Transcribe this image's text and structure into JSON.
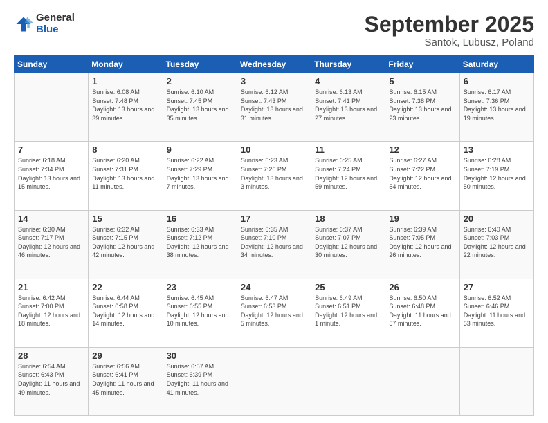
{
  "logo": {
    "general": "General",
    "blue": "Blue"
  },
  "title": {
    "month": "September 2025",
    "location": "Santok, Lubusz, Poland"
  },
  "days_of_week": [
    "Sunday",
    "Monday",
    "Tuesday",
    "Wednesday",
    "Thursday",
    "Friday",
    "Saturday"
  ],
  "weeks": [
    [
      {
        "day": "",
        "sunrise": "",
        "sunset": "",
        "daylight": ""
      },
      {
        "day": "1",
        "sunrise": "Sunrise: 6:08 AM",
        "sunset": "Sunset: 7:48 PM",
        "daylight": "Daylight: 13 hours and 39 minutes."
      },
      {
        "day": "2",
        "sunrise": "Sunrise: 6:10 AM",
        "sunset": "Sunset: 7:45 PM",
        "daylight": "Daylight: 13 hours and 35 minutes."
      },
      {
        "day": "3",
        "sunrise": "Sunrise: 6:12 AM",
        "sunset": "Sunset: 7:43 PM",
        "daylight": "Daylight: 13 hours and 31 minutes."
      },
      {
        "day": "4",
        "sunrise": "Sunrise: 6:13 AM",
        "sunset": "Sunset: 7:41 PM",
        "daylight": "Daylight: 13 hours and 27 minutes."
      },
      {
        "day": "5",
        "sunrise": "Sunrise: 6:15 AM",
        "sunset": "Sunset: 7:38 PM",
        "daylight": "Daylight: 13 hours and 23 minutes."
      },
      {
        "day": "6",
        "sunrise": "Sunrise: 6:17 AM",
        "sunset": "Sunset: 7:36 PM",
        "daylight": "Daylight: 13 hours and 19 minutes."
      }
    ],
    [
      {
        "day": "7",
        "sunrise": "Sunrise: 6:18 AM",
        "sunset": "Sunset: 7:34 PM",
        "daylight": "Daylight: 13 hours and 15 minutes."
      },
      {
        "day": "8",
        "sunrise": "Sunrise: 6:20 AM",
        "sunset": "Sunset: 7:31 PM",
        "daylight": "Daylight: 13 hours and 11 minutes."
      },
      {
        "day": "9",
        "sunrise": "Sunrise: 6:22 AM",
        "sunset": "Sunset: 7:29 PM",
        "daylight": "Daylight: 13 hours and 7 minutes."
      },
      {
        "day": "10",
        "sunrise": "Sunrise: 6:23 AM",
        "sunset": "Sunset: 7:26 PM",
        "daylight": "Daylight: 13 hours and 3 minutes."
      },
      {
        "day": "11",
        "sunrise": "Sunrise: 6:25 AM",
        "sunset": "Sunset: 7:24 PM",
        "daylight": "Daylight: 12 hours and 59 minutes."
      },
      {
        "day": "12",
        "sunrise": "Sunrise: 6:27 AM",
        "sunset": "Sunset: 7:22 PM",
        "daylight": "Daylight: 12 hours and 54 minutes."
      },
      {
        "day": "13",
        "sunrise": "Sunrise: 6:28 AM",
        "sunset": "Sunset: 7:19 PM",
        "daylight": "Daylight: 12 hours and 50 minutes."
      }
    ],
    [
      {
        "day": "14",
        "sunrise": "Sunrise: 6:30 AM",
        "sunset": "Sunset: 7:17 PM",
        "daylight": "Daylight: 12 hours and 46 minutes."
      },
      {
        "day": "15",
        "sunrise": "Sunrise: 6:32 AM",
        "sunset": "Sunset: 7:15 PM",
        "daylight": "Daylight: 12 hours and 42 minutes."
      },
      {
        "day": "16",
        "sunrise": "Sunrise: 6:33 AM",
        "sunset": "Sunset: 7:12 PM",
        "daylight": "Daylight: 12 hours and 38 minutes."
      },
      {
        "day": "17",
        "sunrise": "Sunrise: 6:35 AM",
        "sunset": "Sunset: 7:10 PM",
        "daylight": "Daylight: 12 hours and 34 minutes."
      },
      {
        "day": "18",
        "sunrise": "Sunrise: 6:37 AM",
        "sunset": "Sunset: 7:07 PM",
        "daylight": "Daylight: 12 hours and 30 minutes."
      },
      {
        "day": "19",
        "sunrise": "Sunrise: 6:39 AM",
        "sunset": "Sunset: 7:05 PM",
        "daylight": "Daylight: 12 hours and 26 minutes."
      },
      {
        "day": "20",
        "sunrise": "Sunrise: 6:40 AM",
        "sunset": "Sunset: 7:03 PM",
        "daylight": "Daylight: 12 hours and 22 minutes."
      }
    ],
    [
      {
        "day": "21",
        "sunrise": "Sunrise: 6:42 AM",
        "sunset": "Sunset: 7:00 PM",
        "daylight": "Daylight: 12 hours and 18 minutes."
      },
      {
        "day": "22",
        "sunrise": "Sunrise: 6:44 AM",
        "sunset": "Sunset: 6:58 PM",
        "daylight": "Daylight: 12 hours and 14 minutes."
      },
      {
        "day": "23",
        "sunrise": "Sunrise: 6:45 AM",
        "sunset": "Sunset: 6:55 PM",
        "daylight": "Daylight: 12 hours and 10 minutes."
      },
      {
        "day": "24",
        "sunrise": "Sunrise: 6:47 AM",
        "sunset": "Sunset: 6:53 PM",
        "daylight": "Daylight: 12 hours and 5 minutes."
      },
      {
        "day": "25",
        "sunrise": "Sunrise: 6:49 AM",
        "sunset": "Sunset: 6:51 PM",
        "daylight": "Daylight: 12 hours and 1 minute."
      },
      {
        "day": "26",
        "sunrise": "Sunrise: 6:50 AM",
        "sunset": "Sunset: 6:48 PM",
        "daylight": "Daylight: 11 hours and 57 minutes."
      },
      {
        "day": "27",
        "sunrise": "Sunrise: 6:52 AM",
        "sunset": "Sunset: 6:46 PM",
        "daylight": "Daylight: 11 hours and 53 minutes."
      }
    ],
    [
      {
        "day": "28",
        "sunrise": "Sunrise: 6:54 AM",
        "sunset": "Sunset: 6:43 PM",
        "daylight": "Daylight: 11 hours and 49 minutes."
      },
      {
        "day": "29",
        "sunrise": "Sunrise: 6:56 AM",
        "sunset": "Sunset: 6:41 PM",
        "daylight": "Daylight: 11 hours and 45 minutes."
      },
      {
        "day": "30",
        "sunrise": "Sunrise: 6:57 AM",
        "sunset": "Sunset: 6:39 PM",
        "daylight": "Daylight: 11 hours and 41 minutes."
      },
      {
        "day": "",
        "sunrise": "",
        "sunset": "",
        "daylight": ""
      },
      {
        "day": "",
        "sunrise": "",
        "sunset": "",
        "daylight": ""
      },
      {
        "day": "",
        "sunrise": "",
        "sunset": "",
        "daylight": ""
      },
      {
        "day": "",
        "sunrise": "",
        "sunset": "",
        "daylight": ""
      }
    ]
  ]
}
